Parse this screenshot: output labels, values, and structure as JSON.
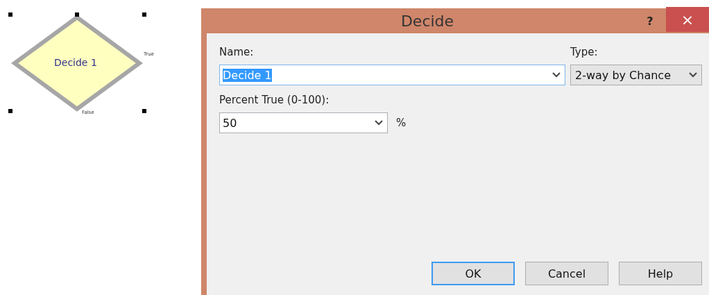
{
  "canvas": {
    "module": {
      "label": "Decide 1",
      "true_label": "True",
      "false_label": "False",
      "selected": true
    }
  },
  "dialog": {
    "title": "Decide",
    "help_glyph": "?",
    "close_glyph": "×",
    "name": {
      "label": "Name:",
      "value": "Decide 1",
      "text_selected": true
    },
    "type": {
      "label": "Type:",
      "value": "2-way by Chance"
    },
    "percent": {
      "label": "Percent True (0-100):",
      "value": "50",
      "unit": "%"
    },
    "buttons": [
      {
        "label": "OK",
        "default": true
      },
      {
        "label": "Cancel",
        "default": false
      },
      {
        "label": "Help",
        "default": false
      }
    ]
  }
}
